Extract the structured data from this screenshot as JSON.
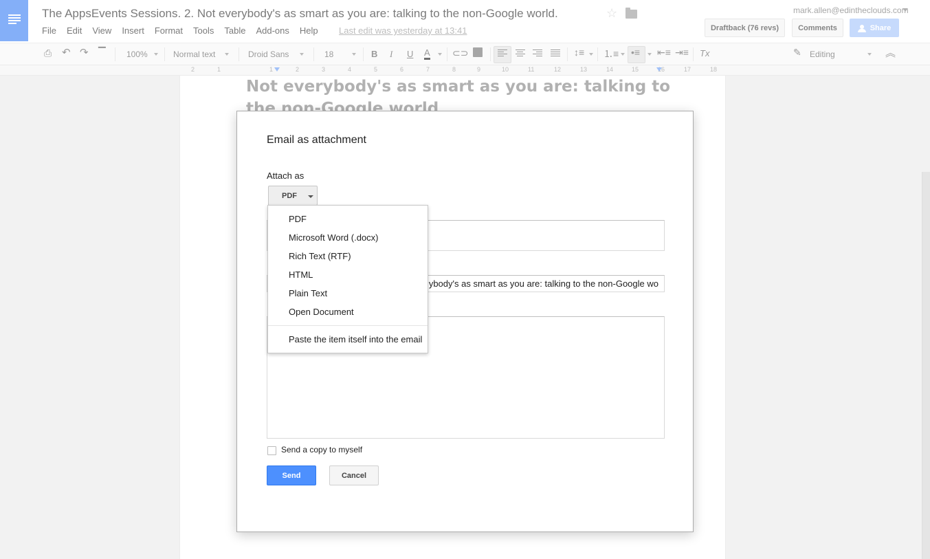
{
  "header": {
    "doc_title": "The AppsEvents Sessions.  2. Not everybody's as smart as you are: talking to the non-Google world.",
    "menu": [
      "File",
      "Edit",
      "View",
      "Insert",
      "Format",
      "Tools",
      "Table",
      "Add-ons",
      "Help"
    ],
    "last_edit": "Last edit was yesterday at 13:41",
    "account": "mark.allen@edintheclouds.com",
    "draftback_label": "Draftback (76 revs)",
    "comments_label": "Comments",
    "share_label": "Share"
  },
  "toolbar": {
    "zoom": "100%",
    "style": "Normal text",
    "font": "Droid Sans",
    "font_size": "18",
    "bold": "B",
    "italic": "I",
    "underline": "U",
    "text_color": "A",
    "clear_format": "Tx",
    "mode": "Editing"
  },
  "ruler": {
    "ticks": [
      "2",
      "1",
      "1",
      "2",
      "3",
      "4",
      "5",
      "6",
      "7",
      "8",
      "9",
      "10",
      "11",
      "12",
      "13",
      "14",
      "15",
      "16",
      "17",
      "18"
    ]
  },
  "document": {
    "heading": "Not everybody's as smart as you are: talking to the non-Google world"
  },
  "dialog": {
    "title": "Email as attachment",
    "attach_label": "Attach as",
    "attach_value": "PDF",
    "subject_value": "ybody's as smart as you are: talking to the non-Google wo",
    "copy_label": "Send a copy to myself",
    "send_label": "Send",
    "cancel_label": "Cancel"
  },
  "dropdown": {
    "options": [
      "PDF",
      "Microsoft Word (.docx)",
      "Rich Text (RTF)",
      "HTML",
      "Plain Text",
      "Open Document"
    ],
    "paste_option": "Paste the item itself into the email"
  },
  "colors": {
    "brand_blue": "#4285f4",
    "send_blue": "#4d90fe",
    "share_disabled": "#a8c7fa"
  }
}
